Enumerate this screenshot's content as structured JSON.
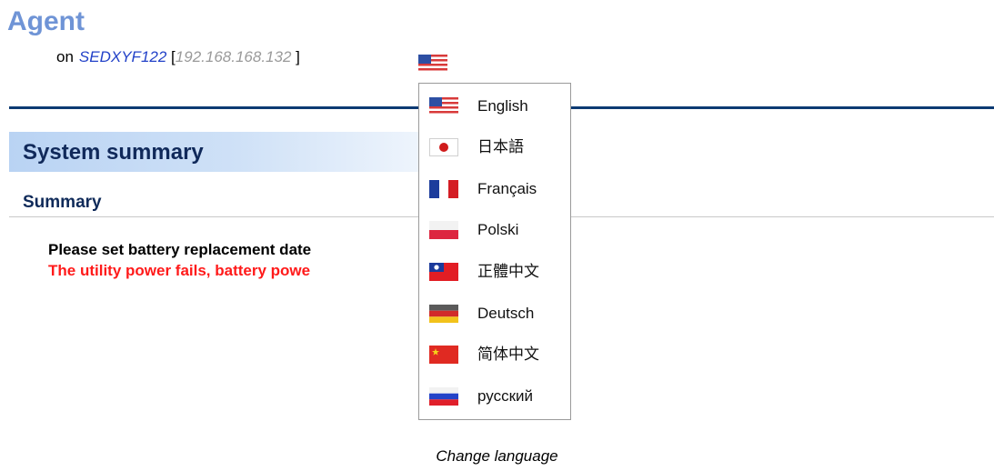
{
  "header": {
    "title": "Agent",
    "on_label": "on",
    "host_name": "SEDXYF122",
    "bracket_open": "[",
    "ip_address": "192.168.168.132",
    "bracket_close": "]",
    "language_toggle_icon": "us-flag-icon"
  },
  "section": {
    "title": "System summary",
    "subtitle": "Summary"
  },
  "messages": {
    "line1": "Please set battery replacement date",
    "line2": "The utility power fails, battery powe",
    "line2_tail": ".",
    "line2_color": "#ff1a1a"
  },
  "language_menu": {
    "items": [
      {
        "label": "English",
        "icon": "us-flag-icon"
      },
      {
        "label": "日本語",
        "icon": "japan-flag-icon"
      },
      {
        "label": "Français",
        "icon": "france-flag-icon"
      },
      {
        "label": "Polski",
        "icon": "poland-flag-icon"
      },
      {
        "label": "正體中文",
        "icon": "taiwan-flag-icon"
      },
      {
        "label": "Deutsch",
        "icon": "germany-flag-icon"
      },
      {
        "label": "简体中文",
        "icon": "china-flag-icon"
      },
      {
        "label": "русский",
        "icon": "russia-flag-icon"
      }
    ]
  },
  "caption": "Change language",
  "colors": {
    "title_blue": "#6f94d6",
    "rule_navy": "#0d3a73",
    "host_blue": "#2342c8"
  }
}
